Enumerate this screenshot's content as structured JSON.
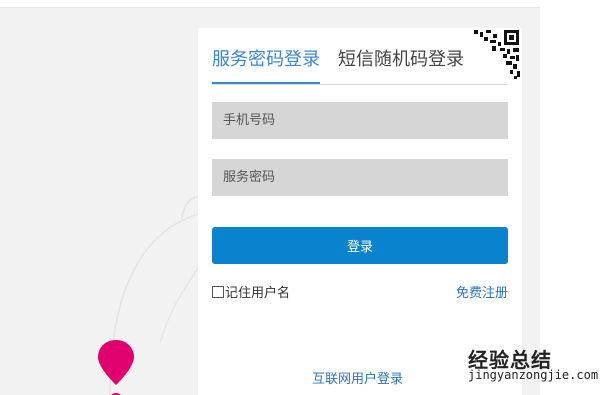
{
  "login": {
    "tabs": {
      "service_password": "服务密码登录",
      "sms_code": "短信随机码登录"
    },
    "qr_icon": "qr-code-icon",
    "phone_placeholder": "手机号码",
    "password_placeholder": "服务密码",
    "submit_label": "登录",
    "remember_label": "记住用户名",
    "register_label": "免费注册",
    "internet_login_label": "互联网用户登录"
  },
  "colors": {
    "accent": "#0a83cf",
    "tab_active": "#3a87c9",
    "link": "#2b74b8",
    "field_bg": "#d6d6d6",
    "marker": "#e0006e"
  },
  "watermark": {
    "title": "经验总结",
    "url": "jingyanzongjie.com"
  }
}
